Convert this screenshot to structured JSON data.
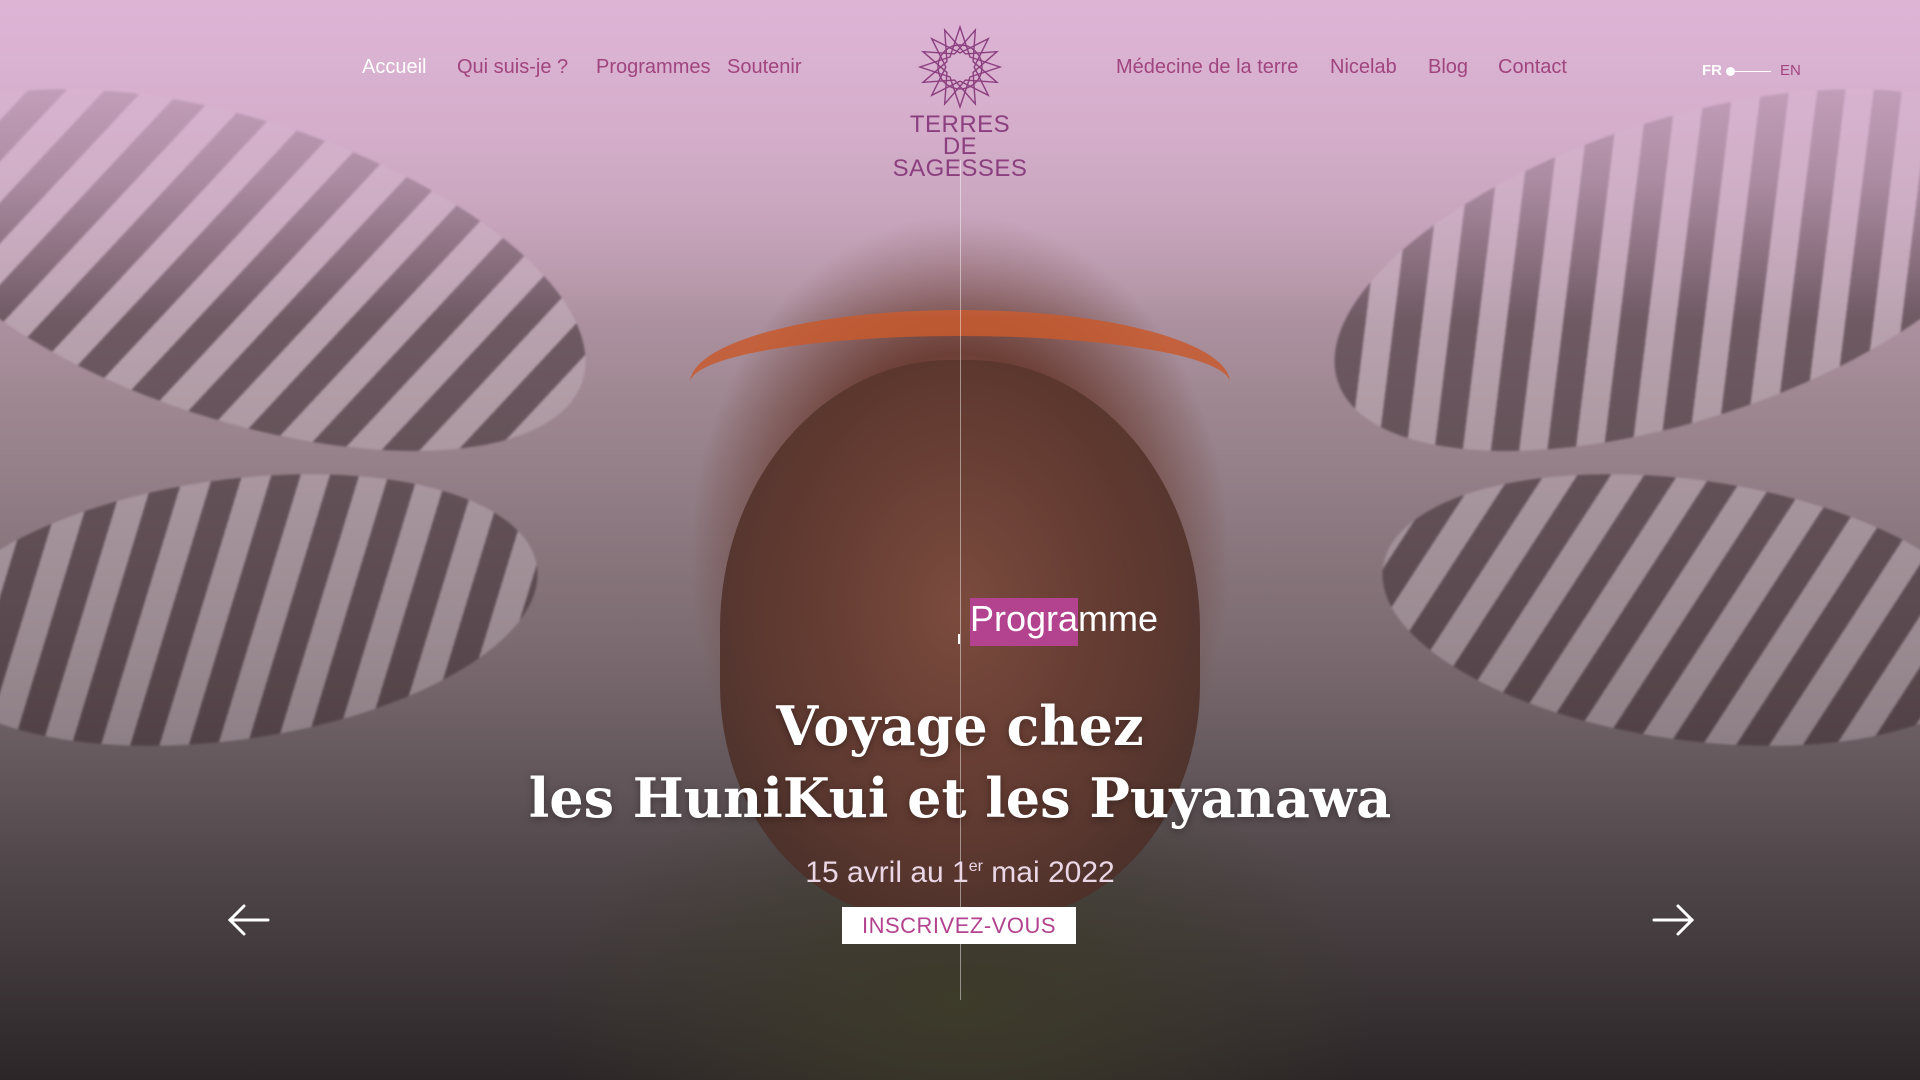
{
  "nav": {
    "left": [
      {
        "label": "Accueil",
        "active": true
      },
      {
        "label": "Qui suis-je ?"
      },
      {
        "label": "Programmes"
      },
      {
        "label": "Soutenir"
      }
    ],
    "right": [
      {
        "label": "Médecine de la terre"
      },
      {
        "label": "Nicelab"
      },
      {
        "label": "Blog"
      },
      {
        "label": "Contact"
      }
    ]
  },
  "logo": {
    "line1": "TERRES DE",
    "line2": "SAGESSES",
    "icon": "mandala-star-icon"
  },
  "lang": {
    "current": "FR",
    "other": "EN"
  },
  "hero": {
    "tag": "Programme",
    "title_line1": "Voyage chez",
    "title_line2": "les HuniKui et les Puyanawa",
    "dates_prefix": "15 avril au 1",
    "dates_sup": "er",
    "dates_suffix": " mai 2022",
    "cta": "INSCRIVEZ-VOUS",
    "prev_icon": "arrow-left-icon",
    "next_icon": "arrow-right-icon"
  },
  "colors": {
    "accent": "#b3438f",
    "nav_text": "#a0457f",
    "logo": "#8b3f7f",
    "overlay": "#deb4d6"
  }
}
